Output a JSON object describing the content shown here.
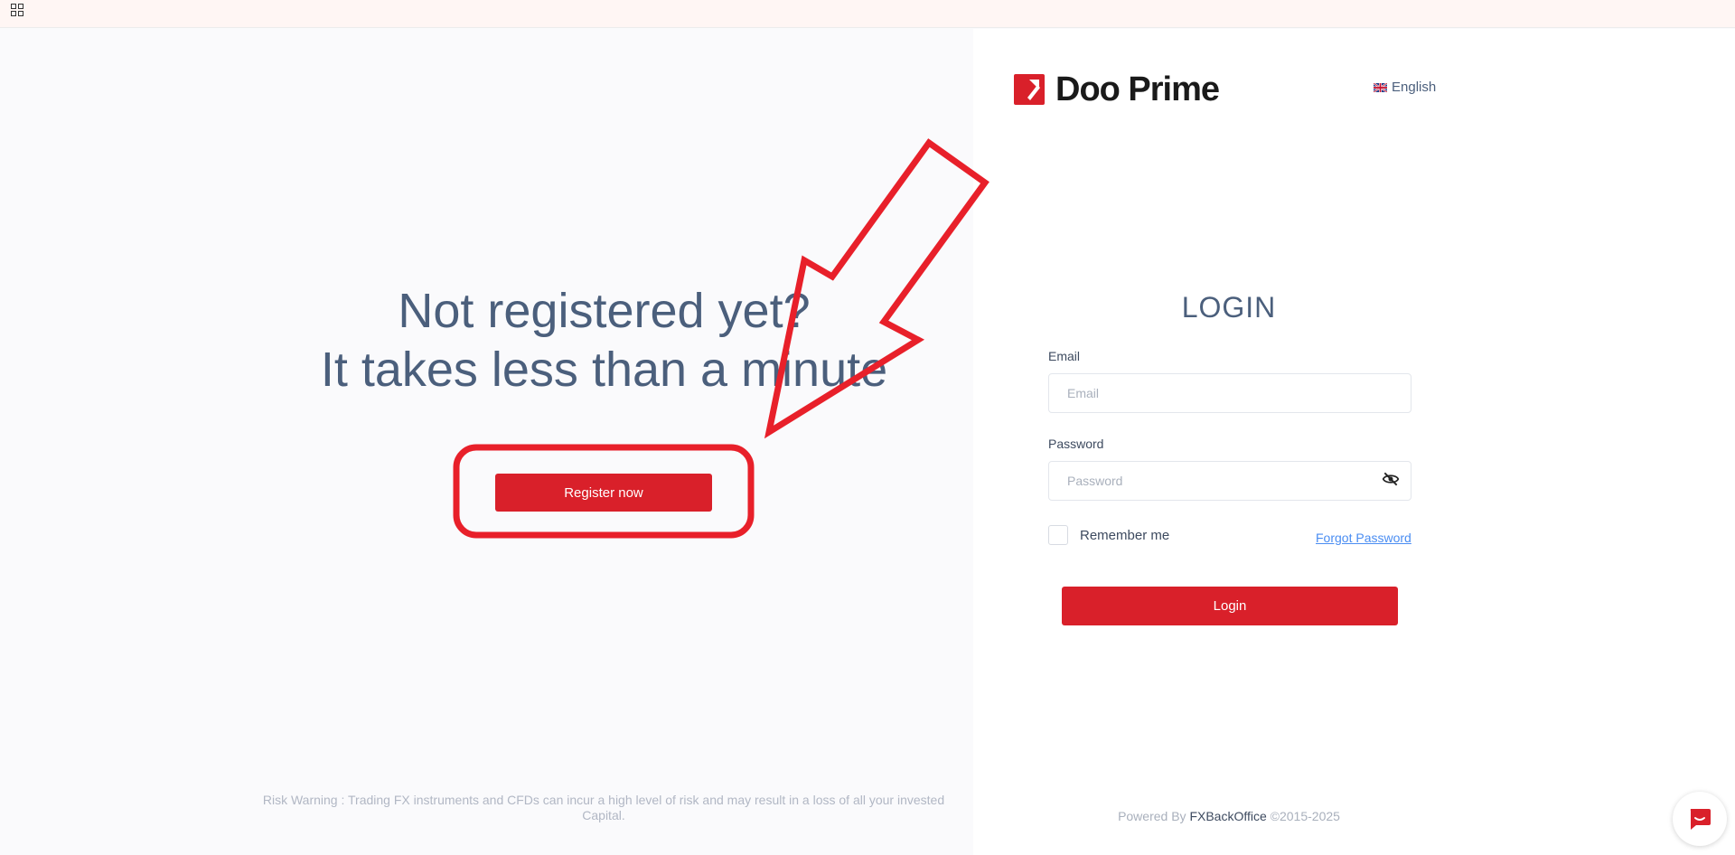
{
  "topbar": {
    "apps_icon": "grid-icon"
  },
  "left": {
    "headline_line1": "Not registered yet?",
    "headline_line2": "It takes less than a minute",
    "register_label": "Register now",
    "risk_warning": "Risk Warning : Trading FX instruments and CFDs can incur a high level of risk and may result in a loss of all your invested Capital."
  },
  "right": {
    "logo_text": "Doo Prime",
    "language": "English",
    "login_title": "LOGIN",
    "email_label": "Email",
    "email_placeholder": "Email",
    "email_value": "",
    "password_label": "Password",
    "password_placeholder": "Password",
    "password_value": "",
    "remember_label": "Remember me",
    "forgot_label": "Forgot Password",
    "login_label": "Login",
    "powered_prefix": "Powered By",
    "powered_brand": "FXBackOffice",
    "powered_suffix": "©2015-2025"
  },
  "colors": {
    "brand_red": "#d9202a",
    "heading_slate": "#4b5f7c",
    "link_blue": "#4a8df2",
    "annotation_red": "#e8202a"
  },
  "icons": {
    "eye": "eye-slash-icon",
    "chat": "chat-icon",
    "flag": "uk-flag-icon",
    "logo": "doo-prime-logo-icon"
  }
}
